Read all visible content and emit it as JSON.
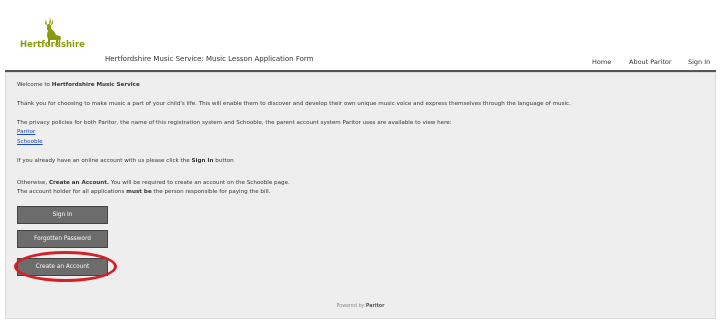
{
  "header": {
    "logo_text": "Hertfordshire",
    "page_title": "Hertfordshire Music Service: Music Lesson Application Form",
    "nav": [
      "Home",
      "About Paritor",
      "Sign In"
    ]
  },
  "main": {
    "welcome_prefix": "Welcome to",
    "welcome_name": "Hertfordshire Music Service",
    "intro": "Thank you for choosing to make music a part of your child's life. This will enable them to discover and develop their own unique music voice and express themselves through the language of music.",
    "privacy": "The privacy policies for both Paritor, the name of this registration system and Schooble, the parent account system Paritor uses are available to view here:",
    "links": [
      "Paritor",
      "Schooble"
    ],
    "signin_prefix": "If you already have an online account with us please click the",
    "signin_bold": "Sign In",
    "signin_suffix": "button",
    "otherwise_prefix": "Otherwise,",
    "otherwise_bold": "Create an Account.",
    "otherwise_suffix": "You will be required to create an account on the Schooble page.",
    "holder_prefix": "The account holder for all applications",
    "holder_bold": "must be",
    "holder_suffix": "the person responsible for paying the bill."
  },
  "buttons": {
    "sign_in": "Sign In",
    "forgotten": "Forgotten Password",
    "create": "Create an Account"
  },
  "footer": {
    "prefix": "Powered by",
    "brand": "Paritor"
  },
  "colors": {
    "brand_green": "#8a9b0f",
    "highlight_ring": "#d62027",
    "button": "#6c6c6c",
    "link": "#1a48b7"
  }
}
